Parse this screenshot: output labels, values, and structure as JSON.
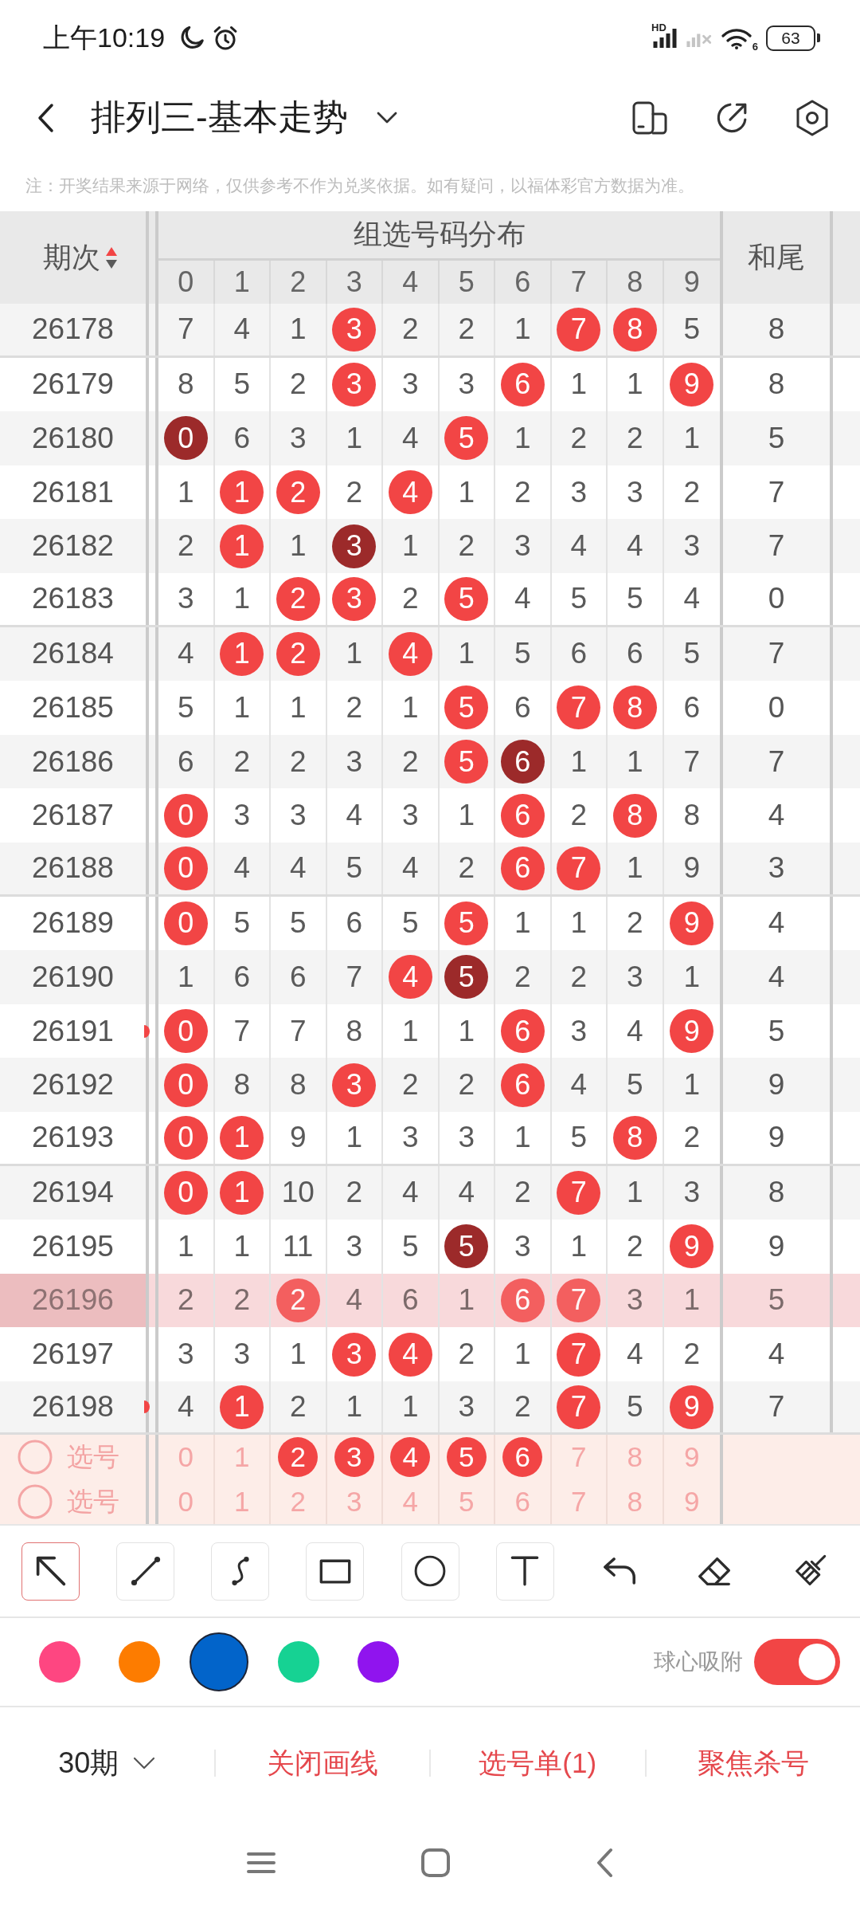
{
  "status_bar": {
    "time": "上午10:19",
    "network_type": "HD",
    "wifi_generation": "6",
    "battery": "63"
  },
  "header": {
    "title": "排列三-基本走势"
  },
  "notice": "注：开奖结果来源于网络，仅供参考不作为兑奖依据。如有疑问，以福体彩官方数据为准。",
  "table": {
    "period_heading": "期次",
    "sort_ascending": true,
    "group_heading": "组选号码分布",
    "digit_headings": [
      "0",
      "1",
      "2",
      "3",
      "4",
      "5",
      "6",
      "7",
      "8",
      "9"
    ],
    "sum_tail_heading": "和尾",
    "rows": [
      {
        "period": "26178",
        "cells": [
          {
            "text": "7",
            "kind": "plain"
          },
          {
            "text": "4",
            "kind": "plain"
          },
          {
            "text": "1",
            "kind": "plain"
          },
          {
            "text": "3",
            "kind": "hit"
          },
          {
            "text": "2",
            "kind": "plain"
          },
          {
            "text": "2",
            "kind": "plain"
          },
          {
            "text": "1",
            "kind": "plain"
          },
          {
            "text": "7",
            "kind": "hit"
          },
          {
            "text": "8",
            "kind": "hit"
          },
          {
            "text": "5",
            "kind": "plain"
          }
        ],
        "sum_tail": "8",
        "highlighted": false,
        "edge_mark": false
      },
      {
        "period": "26179",
        "cells": [
          {
            "text": "8",
            "kind": "plain"
          },
          {
            "text": "5",
            "kind": "plain"
          },
          {
            "text": "2",
            "kind": "plain"
          },
          {
            "text": "3",
            "kind": "hit"
          },
          {
            "text": "3",
            "kind": "plain"
          },
          {
            "text": "3",
            "kind": "plain"
          },
          {
            "text": "6",
            "kind": "hit"
          },
          {
            "text": "1",
            "kind": "plain"
          },
          {
            "text": "1",
            "kind": "plain"
          },
          {
            "text": "9",
            "kind": "hit"
          }
        ],
        "sum_tail": "8",
        "highlighted": false,
        "edge_mark": false
      },
      {
        "period": "26180",
        "cells": [
          {
            "text": "0",
            "kind": "double"
          },
          {
            "text": "6",
            "kind": "plain"
          },
          {
            "text": "3",
            "kind": "plain"
          },
          {
            "text": "1",
            "kind": "plain"
          },
          {
            "text": "4",
            "kind": "plain"
          },
          {
            "text": "5",
            "kind": "hit"
          },
          {
            "text": "1",
            "kind": "plain"
          },
          {
            "text": "2",
            "kind": "plain"
          },
          {
            "text": "2",
            "kind": "plain"
          },
          {
            "text": "1",
            "kind": "plain"
          }
        ],
        "sum_tail": "5",
        "highlighted": false,
        "edge_mark": false
      },
      {
        "period": "26181",
        "cells": [
          {
            "text": "1",
            "kind": "plain"
          },
          {
            "text": "1",
            "kind": "hit"
          },
          {
            "text": "2",
            "kind": "hit"
          },
          {
            "text": "2",
            "kind": "plain"
          },
          {
            "text": "4",
            "kind": "hit"
          },
          {
            "text": "1",
            "kind": "plain"
          },
          {
            "text": "2",
            "kind": "plain"
          },
          {
            "text": "3",
            "kind": "plain"
          },
          {
            "text": "3",
            "kind": "plain"
          },
          {
            "text": "2",
            "kind": "plain"
          }
        ],
        "sum_tail": "7",
        "highlighted": false,
        "edge_mark": false
      },
      {
        "period": "26182",
        "cells": [
          {
            "text": "2",
            "kind": "plain"
          },
          {
            "text": "1",
            "kind": "hit"
          },
          {
            "text": "1",
            "kind": "plain"
          },
          {
            "text": "3",
            "kind": "double"
          },
          {
            "text": "1",
            "kind": "plain"
          },
          {
            "text": "2",
            "kind": "plain"
          },
          {
            "text": "3",
            "kind": "plain"
          },
          {
            "text": "4",
            "kind": "plain"
          },
          {
            "text": "4",
            "kind": "plain"
          },
          {
            "text": "3",
            "kind": "plain"
          }
        ],
        "sum_tail": "7",
        "highlighted": false,
        "edge_mark": false
      },
      {
        "period": "26183",
        "cells": [
          {
            "text": "3",
            "kind": "plain"
          },
          {
            "text": "1",
            "kind": "plain"
          },
          {
            "text": "2",
            "kind": "hit"
          },
          {
            "text": "3",
            "kind": "hit"
          },
          {
            "text": "2",
            "kind": "plain"
          },
          {
            "text": "5",
            "kind": "hit"
          },
          {
            "text": "4",
            "kind": "plain"
          },
          {
            "text": "5",
            "kind": "plain"
          },
          {
            "text": "5",
            "kind": "plain"
          },
          {
            "text": "4",
            "kind": "plain"
          }
        ],
        "sum_tail": "0",
        "highlighted": false,
        "edge_mark": false
      },
      {
        "period": "26184",
        "cells": [
          {
            "text": "4",
            "kind": "plain"
          },
          {
            "text": "1",
            "kind": "hit"
          },
          {
            "text": "2",
            "kind": "hit"
          },
          {
            "text": "1",
            "kind": "plain"
          },
          {
            "text": "4",
            "kind": "hit"
          },
          {
            "text": "1",
            "kind": "plain"
          },
          {
            "text": "5",
            "kind": "plain"
          },
          {
            "text": "6",
            "kind": "plain"
          },
          {
            "text": "6",
            "kind": "plain"
          },
          {
            "text": "5",
            "kind": "plain"
          }
        ],
        "sum_tail": "7",
        "highlighted": false,
        "edge_mark": false
      },
      {
        "period": "26185",
        "cells": [
          {
            "text": "5",
            "kind": "plain"
          },
          {
            "text": "1",
            "kind": "plain"
          },
          {
            "text": "1",
            "kind": "plain"
          },
          {
            "text": "2",
            "kind": "plain"
          },
          {
            "text": "1",
            "kind": "plain"
          },
          {
            "text": "5",
            "kind": "hit"
          },
          {
            "text": "6",
            "kind": "plain"
          },
          {
            "text": "7",
            "kind": "hit"
          },
          {
            "text": "8",
            "kind": "hit"
          },
          {
            "text": "6",
            "kind": "plain"
          }
        ],
        "sum_tail": "0",
        "highlighted": false,
        "edge_mark": false
      },
      {
        "period": "26186",
        "cells": [
          {
            "text": "6",
            "kind": "plain"
          },
          {
            "text": "2",
            "kind": "plain"
          },
          {
            "text": "2",
            "kind": "plain"
          },
          {
            "text": "3",
            "kind": "plain"
          },
          {
            "text": "2",
            "kind": "plain"
          },
          {
            "text": "5",
            "kind": "hit"
          },
          {
            "text": "6",
            "kind": "double"
          },
          {
            "text": "1",
            "kind": "plain"
          },
          {
            "text": "1",
            "kind": "plain"
          },
          {
            "text": "7",
            "kind": "plain"
          }
        ],
        "sum_tail": "7",
        "highlighted": false,
        "edge_mark": false
      },
      {
        "period": "26187",
        "cells": [
          {
            "text": "0",
            "kind": "hit"
          },
          {
            "text": "3",
            "kind": "plain"
          },
          {
            "text": "3",
            "kind": "plain"
          },
          {
            "text": "4",
            "kind": "plain"
          },
          {
            "text": "3",
            "kind": "plain"
          },
          {
            "text": "1",
            "kind": "plain"
          },
          {
            "text": "6",
            "kind": "hit"
          },
          {
            "text": "2",
            "kind": "plain"
          },
          {
            "text": "8",
            "kind": "hit"
          },
          {
            "text": "8",
            "kind": "plain"
          }
        ],
        "sum_tail": "4",
        "highlighted": false,
        "edge_mark": false
      },
      {
        "period": "26188",
        "cells": [
          {
            "text": "0",
            "kind": "hit"
          },
          {
            "text": "4",
            "kind": "plain"
          },
          {
            "text": "4",
            "kind": "plain"
          },
          {
            "text": "5",
            "kind": "plain"
          },
          {
            "text": "4",
            "kind": "plain"
          },
          {
            "text": "2",
            "kind": "plain"
          },
          {
            "text": "6",
            "kind": "hit"
          },
          {
            "text": "7",
            "kind": "hit"
          },
          {
            "text": "1",
            "kind": "plain"
          },
          {
            "text": "9",
            "kind": "plain"
          }
        ],
        "sum_tail": "3",
        "highlighted": false,
        "edge_mark": false
      },
      {
        "period": "26189",
        "cells": [
          {
            "text": "0",
            "kind": "hit"
          },
          {
            "text": "5",
            "kind": "plain"
          },
          {
            "text": "5",
            "kind": "plain"
          },
          {
            "text": "6",
            "kind": "plain"
          },
          {
            "text": "5",
            "kind": "plain"
          },
          {
            "text": "5",
            "kind": "hit"
          },
          {
            "text": "1",
            "kind": "plain"
          },
          {
            "text": "1",
            "kind": "plain"
          },
          {
            "text": "2",
            "kind": "plain"
          },
          {
            "text": "9",
            "kind": "hit"
          }
        ],
        "sum_tail": "4",
        "highlighted": false,
        "edge_mark": false
      },
      {
        "period": "26190",
        "cells": [
          {
            "text": "1",
            "kind": "plain"
          },
          {
            "text": "6",
            "kind": "plain"
          },
          {
            "text": "6",
            "kind": "plain"
          },
          {
            "text": "7",
            "kind": "plain"
          },
          {
            "text": "4",
            "kind": "hit"
          },
          {
            "text": "5",
            "kind": "double"
          },
          {
            "text": "2",
            "kind": "plain"
          },
          {
            "text": "2",
            "kind": "plain"
          },
          {
            "text": "3",
            "kind": "plain"
          },
          {
            "text": "1",
            "kind": "plain"
          }
        ],
        "sum_tail": "4",
        "highlighted": false,
        "edge_mark": false
      },
      {
        "period": "26191",
        "cells": [
          {
            "text": "0",
            "kind": "hit"
          },
          {
            "text": "7",
            "kind": "plain"
          },
          {
            "text": "7",
            "kind": "plain"
          },
          {
            "text": "8",
            "kind": "plain"
          },
          {
            "text": "1",
            "kind": "plain"
          },
          {
            "text": "1",
            "kind": "plain"
          },
          {
            "text": "6",
            "kind": "hit"
          },
          {
            "text": "3",
            "kind": "plain"
          },
          {
            "text": "4",
            "kind": "plain"
          },
          {
            "text": "9",
            "kind": "hit"
          }
        ],
        "sum_tail": "5",
        "highlighted": false,
        "edge_mark": true
      },
      {
        "period": "26192",
        "cells": [
          {
            "text": "0",
            "kind": "hit"
          },
          {
            "text": "8",
            "kind": "plain"
          },
          {
            "text": "8",
            "kind": "plain"
          },
          {
            "text": "3",
            "kind": "hit"
          },
          {
            "text": "2",
            "kind": "plain"
          },
          {
            "text": "2",
            "kind": "plain"
          },
          {
            "text": "6",
            "kind": "hit"
          },
          {
            "text": "4",
            "kind": "plain"
          },
          {
            "text": "5",
            "kind": "plain"
          },
          {
            "text": "1",
            "kind": "plain"
          }
        ],
        "sum_tail": "9",
        "highlighted": false,
        "edge_mark": false
      },
      {
        "period": "26193",
        "cells": [
          {
            "text": "0",
            "kind": "hit"
          },
          {
            "text": "1",
            "kind": "hit"
          },
          {
            "text": "9",
            "kind": "plain"
          },
          {
            "text": "1",
            "kind": "plain"
          },
          {
            "text": "3",
            "kind": "plain"
          },
          {
            "text": "3",
            "kind": "plain"
          },
          {
            "text": "1",
            "kind": "plain"
          },
          {
            "text": "5",
            "kind": "plain"
          },
          {
            "text": "8",
            "kind": "hit"
          },
          {
            "text": "2",
            "kind": "plain"
          }
        ],
        "sum_tail": "9",
        "highlighted": false,
        "edge_mark": false
      },
      {
        "period": "26194",
        "cells": [
          {
            "text": "0",
            "kind": "hit"
          },
          {
            "text": "1",
            "kind": "hit"
          },
          {
            "text": "10",
            "kind": "plain"
          },
          {
            "text": "2",
            "kind": "plain"
          },
          {
            "text": "4",
            "kind": "plain"
          },
          {
            "text": "4",
            "kind": "plain"
          },
          {
            "text": "2",
            "kind": "plain"
          },
          {
            "text": "7",
            "kind": "hit"
          },
          {
            "text": "1",
            "kind": "plain"
          },
          {
            "text": "3",
            "kind": "plain"
          }
        ],
        "sum_tail": "8",
        "highlighted": false,
        "edge_mark": false
      },
      {
        "period": "26195",
        "cells": [
          {
            "text": "1",
            "kind": "plain"
          },
          {
            "text": "1",
            "kind": "plain"
          },
          {
            "text": "11",
            "kind": "plain"
          },
          {
            "text": "3",
            "kind": "plain"
          },
          {
            "text": "5",
            "kind": "plain"
          },
          {
            "text": "5",
            "kind": "double"
          },
          {
            "text": "3",
            "kind": "plain"
          },
          {
            "text": "1",
            "kind": "plain"
          },
          {
            "text": "2",
            "kind": "plain"
          },
          {
            "text": "9",
            "kind": "hit"
          }
        ],
        "sum_tail": "9",
        "highlighted": false,
        "edge_mark": false
      },
      {
        "period": "26196",
        "cells": [
          {
            "text": "2",
            "kind": "plain"
          },
          {
            "text": "2",
            "kind": "plain"
          },
          {
            "text": "2",
            "kind": "hit"
          },
          {
            "text": "4",
            "kind": "plain"
          },
          {
            "text": "6",
            "kind": "plain"
          },
          {
            "text": "1",
            "kind": "plain"
          },
          {
            "text": "6",
            "kind": "hit"
          },
          {
            "text": "7",
            "kind": "hit"
          },
          {
            "text": "3",
            "kind": "plain"
          },
          {
            "text": "1",
            "kind": "plain"
          }
        ],
        "sum_tail": "5",
        "highlighted": true,
        "edge_mark": false
      },
      {
        "period": "26197",
        "cells": [
          {
            "text": "3",
            "kind": "plain"
          },
          {
            "text": "3",
            "kind": "plain"
          },
          {
            "text": "1",
            "kind": "plain"
          },
          {
            "text": "3",
            "kind": "hit"
          },
          {
            "text": "4",
            "kind": "hit"
          },
          {
            "text": "2",
            "kind": "plain"
          },
          {
            "text": "1",
            "kind": "plain"
          },
          {
            "text": "7",
            "kind": "hit"
          },
          {
            "text": "4",
            "kind": "plain"
          },
          {
            "text": "2",
            "kind": "plain"
          }
        ],
        "sum_tail": "4",
        "highlighted": false,
        "edge_mark": false
      },
      {
        "period": "26198",
        "cells": [
          {
            "text": "4",
            "kind": "plain"
          },
          {
            "text": "1",
            "kind": "hit"
          },
          {
            "text": "2",
            "kind": "plain"
          },
          {
            "text": "1",
            "kind": "plain"
          },
          {
            "text": "1",
            "kind": "plain"
          },
          {
            "text": "3",
            "kind": "plain"
          },
          {
            "text": "2",
            "kind": "plain"
          },
          {
            "text": "7",
            "kind": "hit"
          },
          {
            "text": "5",
            "kind": "plain"
          },
          {
            "text": "9",
            "kind": "hit"
          }
        ],
        "sum_tail": "7",
        "highlighted": false,
        "edge_mark": true
      }
    ],
    "pick_rows": [
      {
        "label": "选号",
        "checked": false,
        "digits": [
          {
            "text": "0",
            "selected": false
          },
          {
            "text": "1",
            "selected": false
          },
          {
            "text": "2",
            "selected": true
          },
          {
            "text": "3",
            "selected": true
          },
          {
            "text": "4",
            "selected": true
          },
          {
            "text": "5",
            "selected": true
          },
          {
            "text": "6",
            "selected": true
          },
          {
            "text": "7",
            "selected": false
          },
          {
            "text": "8",
            "selected": false
          },
          {
            "text": "9",
            "selected": false
          }
        ]
      },
      {
        "label": "选号",
        "checked": false,
        "digits": [
          {
            "text": "0",
            "selected": false
          },
          {
            "text": "1",
            "selected": false
          },
          {
            "text": "2",
            "selected": false
          },
          {
            "text": "3",
            "selected": false
          },
          {
            "text": "4",
            "selected": false
          },
          {
            "text": "5",
            "selected": false
          },
          {
            "text": "6",
            "selected": false
          },
          {
            "text": "7",
            "selected": false
          },
          {
            "text": "8",
            "selected": false
          },
          {
            "text": "9",
            "selected": false
          }
        ]
      }
    ]
  },
  "drawing_tools": [
    {
      "kind": "arrow",
      "selected": true
    },
    {
      "kind": "line",
      "selected": false
    },
    {
      "kind": "curve",
      "selected": false
    },
    {
      "kind": "rectangle",
      "selected": false
    },
    {
      "kind": "ellipse",
      "selected": false
    },
    {
      "kind": "text",
      "selected": false
    }
  ],
  "edit_actions": [
    {
      "kind": "undo"
    },
    {
      "kind": "eraser"
    },
    {
      "kind": "clear"
    }
  ],
  "palette": {
    "colors": [
      {
        "color": "#fe4681",
        "selected": false
      },
      {
        "color": "#fd7c00",
        "selected": false
      },
      {
        "color": "#0264ca",
        "selected": true
      },
      {
        "color": "#16d293",
        "selected": false
      },
      {
        "color": "#9014ee",
        "selected": false
      }
    ]
  },
  "snap_to_center": {
    "label": "球心吸附",
    "on": true
  },
  "bottom_bar": {
    "period_filter": "30期",
    "actions": [
      "关闭画线",
      "选号单(1)",
      "聚焦杀号"
    ]
  }
}
